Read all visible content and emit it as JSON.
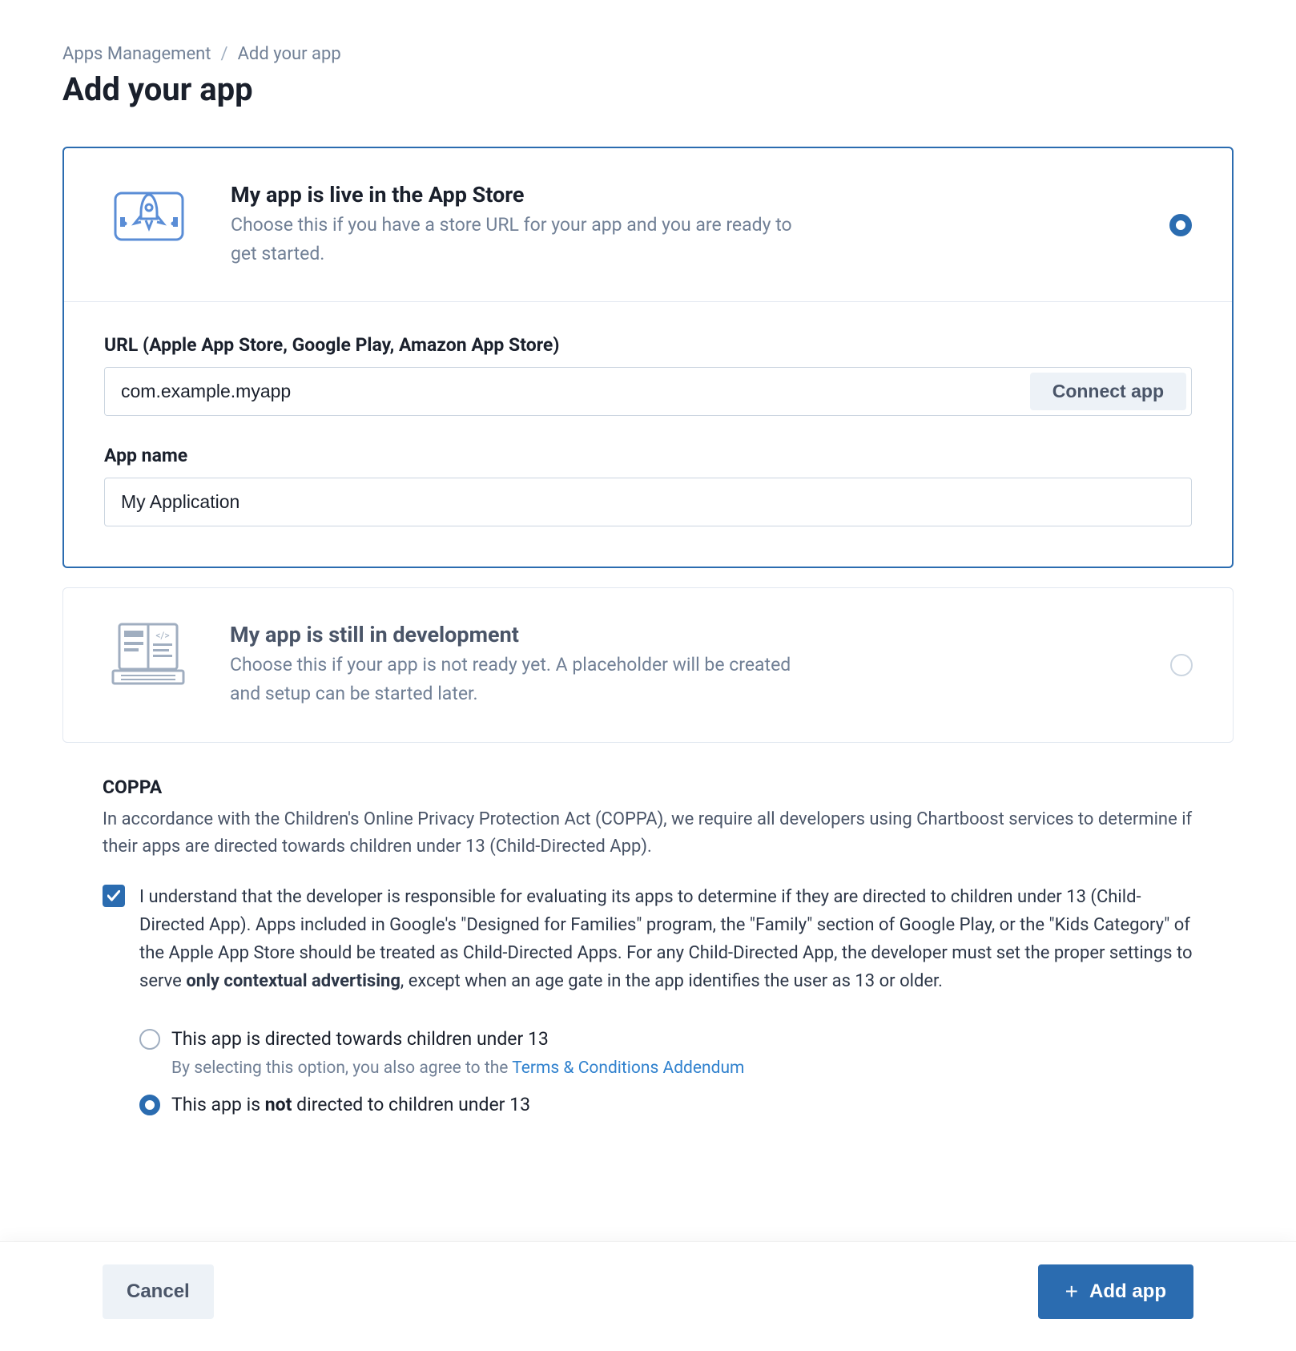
{
  "breadcrumb": {
    "parent": "Apps Management",
    "current": "Add your app"
  },
  "page_title": "Add your app",
  "options": {
    "live": {
      "title": "My app is live in the App Store",
      "desc": "Choose this if you have a store URL for your app and you are ready to get started.",
      "selected": true,
      "url_label": "URL (Apple App Store, Google Play, Amazon App Store)",
      "url_value": "com.example.myapp",
      "connect_label": "Connect app",
      "name_label": "App name",
      "name_value": "My Application"
    },
    "dev": {
      "title": "My app is still in development",
      "desc": "Choose this if your app is not ready yet. A placeholder will be created and setup can be started later.",
      "selected": false
    }
  },
  "coppa": {
    "title": "COPPA",
    "intro": "In accordance with the Children's Online Privacy Protection Act (COPPA), we require all developers using Chartboost services to determine if their apps are directed towards children under 13 (Child-Directed App).",
    "ack_checked": true,
    "ack_prefix": "I understand that the developer is responsible for evaluating its apps to determine if they are directed to children under 13 (Child-Directed App). Apps included in Google's \"Designed for Families\" program, the \"Family\" section of Google Play, or the \"Kids Category\" of the Apple App Store should be treated as Child-Directed Apps. For any Child-Directed App, the developer must set the proper settings to serve ",
    "ack_strong": "only contextual advertising",
    "ack_suffix": ", except when an age gate in the app identifies the user as 13 or older.",
    "radio_directed": {
      "label": "This app is directed towards children under 13",
      "sub_prefix": "By selecting this option, you also agree to the ",
      "sub_link": "Terms & Conditions Addendum",
      "selected": false
    },
    "radio_not_directed": {
      "label_prefix": "This app is ",
      "label_strong": "not",
      "label_suffix": " directed to children under 13",
      "selected": true
    }
  },
  "footer": {
    "cancel": "Cancel",
    "add": "Add app"
  }
}
